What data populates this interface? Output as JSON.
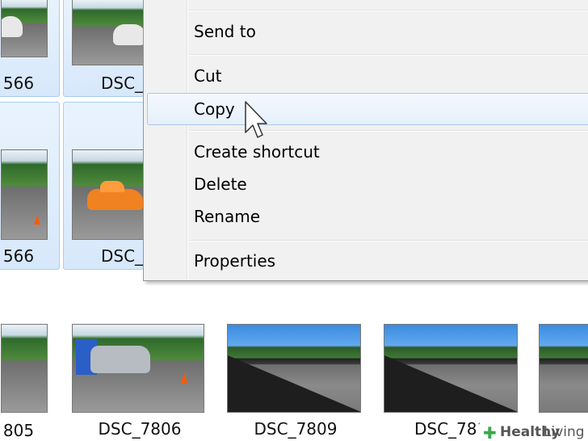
{
  "context_menu": {
    "items": [
      {
        "label": "Send to"
      },
      {
        "label": "Cut"
      },
      {
        "label": "Copy"
      },
      {
        "label": "Create shortcut"
      },
      {
        "label": "Delete"
      },
      {
        "label": "Rename"
      },
      {
        "label": "Properties"
      }
    ],
    "hovered": "Copy"
  },
  "files": {
    "row1": [
      "566",
      "DSC_"
    ],
    "row2": [
      "566",
      "DSC_"
    ],
    "row3": [
      "805",
      "DSC_7806",
      "DSC_7809",
      "DSC_781"
    ]
  },
  "watermark": {
    "mark": "✚",
    "brand_bold": "Healthy",
    "brand_light": "Living"
  },
  "colors": {
    "selection": "#d7e8fb",
    "menu_bg": "#f1f1f1",
    "hover_border": "#a8c8ea"
  }
}
